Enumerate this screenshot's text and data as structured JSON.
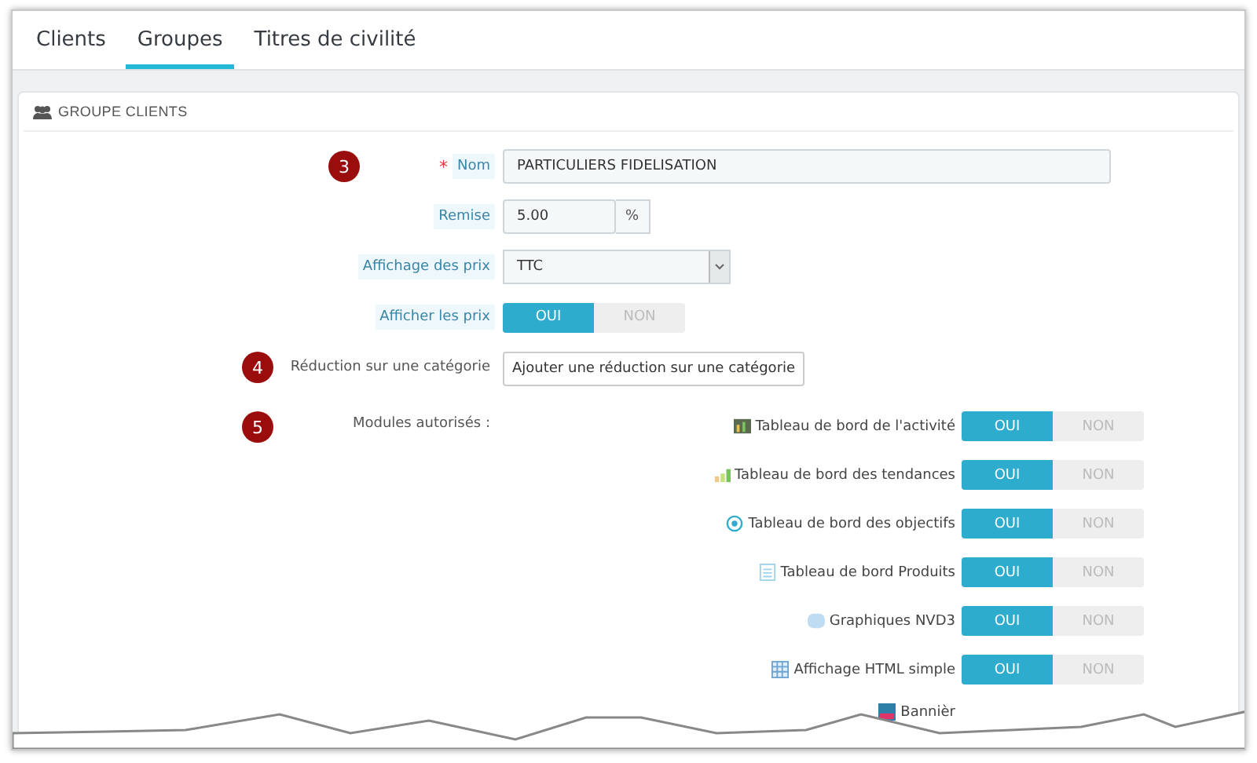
{
  "tabs": [
    {
      "label": "Clients",
      "selected": false
    },
    {
      "label": "Groupes",
      "selected": true
    },
    {
      "label": "Titres de civilité",
      "selected": false
    }
  ],
  "panel": {
    "title": "GROUPE CLIENTS"
  },
  "fields": [
    {
      "kind": "text",
      "label": "Nom",
      "required_mark": "*",
      "value": "PARTICULIERS FIDELISATION",
      "callout": "3"
    },
    {
      "kind": "addon",
      "label": "Remise",
      "value": "5.00",
      "addon": "%"
    },
    {
      "kind": "select",
      "label": "Affichage des prix",
      "value": "TTC"
    },
    {
      "kind": "toggle",
      "label": "Afficher les prix",
      "on": "OUI",
      "off": "NON",
      "selected": true
    },
    {
      "kind": "button",
      "label": "Réduction sur une catégorie",
      "value": "Ajouter une réduction sur une catégorie",
      "callout": "4"
    }
  ],
  "modules": {
    "label": "Modules autorisés :",
    "callout": "5",
    "items": [
      {
        "kind": "chart",
        "name": "Tableau de bord de l'activité",
        "on": "OUI",
        "off": "NON",
        "selected": true
      },
      {
        "kind": "bars",
        "name": "Tableau de bord des tendances",
        "on": "OUI",
        "off": "NON",
        "selected": true
      },
      {
        "kind": "target",
        "name": "Tableau de bord des objectifs",
        "on": "OUI",
        "off": "NON",
        "selected": true
      },
      {
        "kind": "list",
        "name": "Tableau de bord Produits",
        "on": "OUI",
        "off": "NON",
        "selected": true
      },
      {
        "kind": "cloud",
        "name": "Graphiques NVD3",
        "on": "OUI",
        "off": "NON",
        "selected": true
      },
      {
        "kind": "grid",
        "name": "Affichage HTML simple",
        "on": "OUI",
        "off": "NON",
        "selected": true
      },
      {
        "kind": "banner",
        "name": "Bannièr"
      }
    ]
  }
}
